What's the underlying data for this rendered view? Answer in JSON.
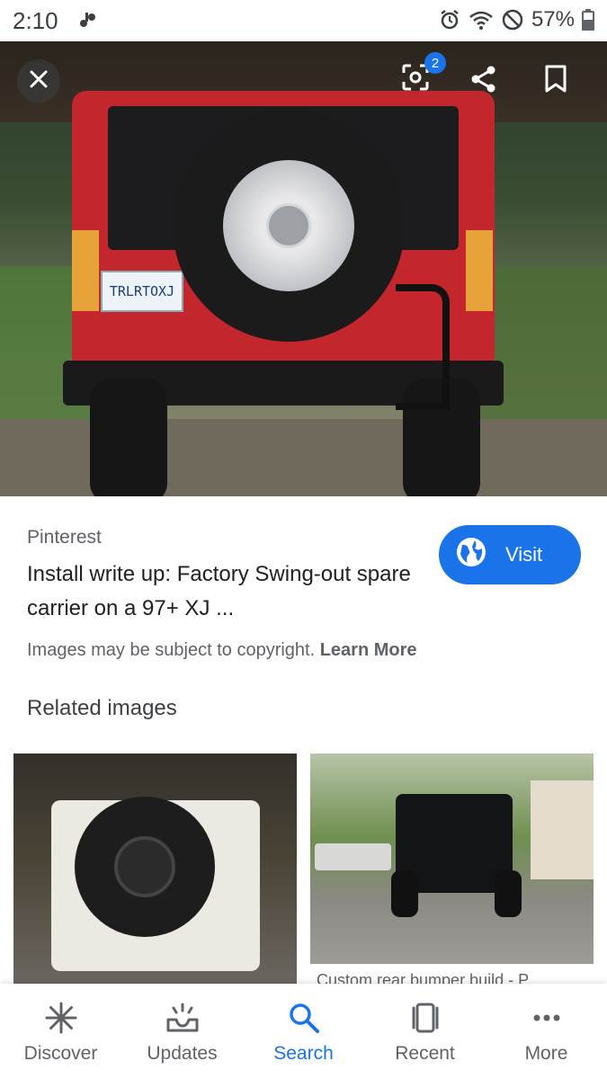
{
  "status_bar": {
    "time": "2:10",
    "battery": "57%"
  },
  "hero": {
    "plate_text": "TRLRTOXJ",
    "lens_badge_count": "2"
  },
  "result": {
    "source": "Pinterest",
    "title": "Install write up: Factory Swing-out spare carrier on a 97+ XJ ...",
    "visit_label": "Visit",
    "copyright_text": "Images may be subject to copyright.",
    "learn_more": "Learn More"
  },
  "related": {
    "heading": "Related images",
    "caption_2": "Custom rear bumper build - P..."
  },
  "bottom_nav": {
    "items": [
      {
        "label": "Discover",
        "icon": "asterisk-icon"
      },
      {
        "label": "Updates",
        "icon": "updates-tray-icon"
      },
      {
        "label": "Search",
        "icon": "search-icon"
      },
      {
        "label": "Recent",
        "icon": "recent-icon"
      },
      {
        "label": "More",
        "icon": "more-dots-icon"
      }
    ],
    "active": "Search"
  },
  "colors": {
    "accent": "#1a73e8",
    "text_primary": "#202124",
    "text_secondary": "#5f6368"
  }
}
